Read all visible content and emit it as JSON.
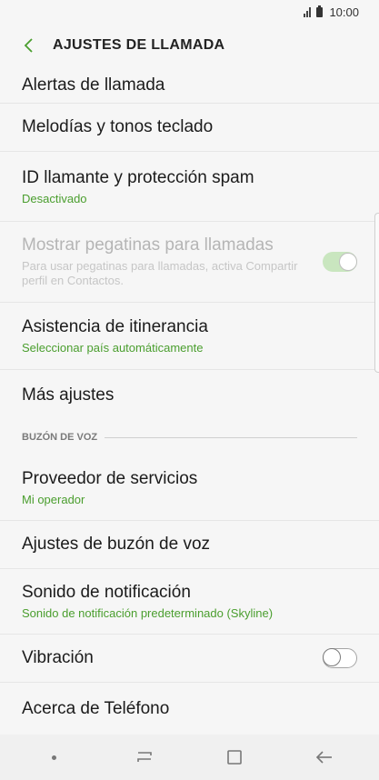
{
  "status_bar": {
    "time": "10:00",
    "signal_icon": "signal-icon",
    "battery_icon": "battery-icon"
  },
  "header": {
    "title": "AJUSTES DE LLAMADA",
    "back_icon": "back-arrow-icon"
  },
  "colors": {
    "accent": "#4a9e2e",
    "background": "#f6f6f6"
  },
  "items": [
    {
      "label": "Alertas de llamada",
      "sub": ""
    },
    {
      "label": "Melodías y tonos teclado",
      "sub": ""
    },
    {
      "label": "ID llamante y protección spam",
      "sub": "Desactivado"
    },
    {
      "label": "Mostrar pegatinas para llamadas",
      "sub": "Para usar pegatinas para llamadas, activa Compartir perfil en Contactos.",
      "toggle": "on",
      "disabled": true
    },
    {
      "label": "Asistencia de itinerancia",
      "sub": "Seleccionar país automáticamente"
    },
    {
      "label": "Más ajustes",
      "sub": ""
    }
  ],
  "voicemail_section": {
    "title": "BUZÓN DE VOZ"
  },
  "voicemail_items": [
    {
      "label": "Proveedor de servicios",
      "sub": "Mi operador"
    },
    {
      "label": "Ajustes de buzón de voz",
      "sub": ""
    },
    {
      "label": "Sonido de notificación",
      "sub": "Sonido de notificación predeterminado (Skyline)"
    },
    {
      "label": "Vibración",
      "sub": "",
      "toggle": "off"
    },
    {
      "label": "Acerca de Teléfono",
      "sub": ""
    }
  ],
  "navbar": {
    "icons": [
      "dot-icon",
      "recent-apps-icon",
      "home-icon",
      "back-icon"
    ]
  }
}
